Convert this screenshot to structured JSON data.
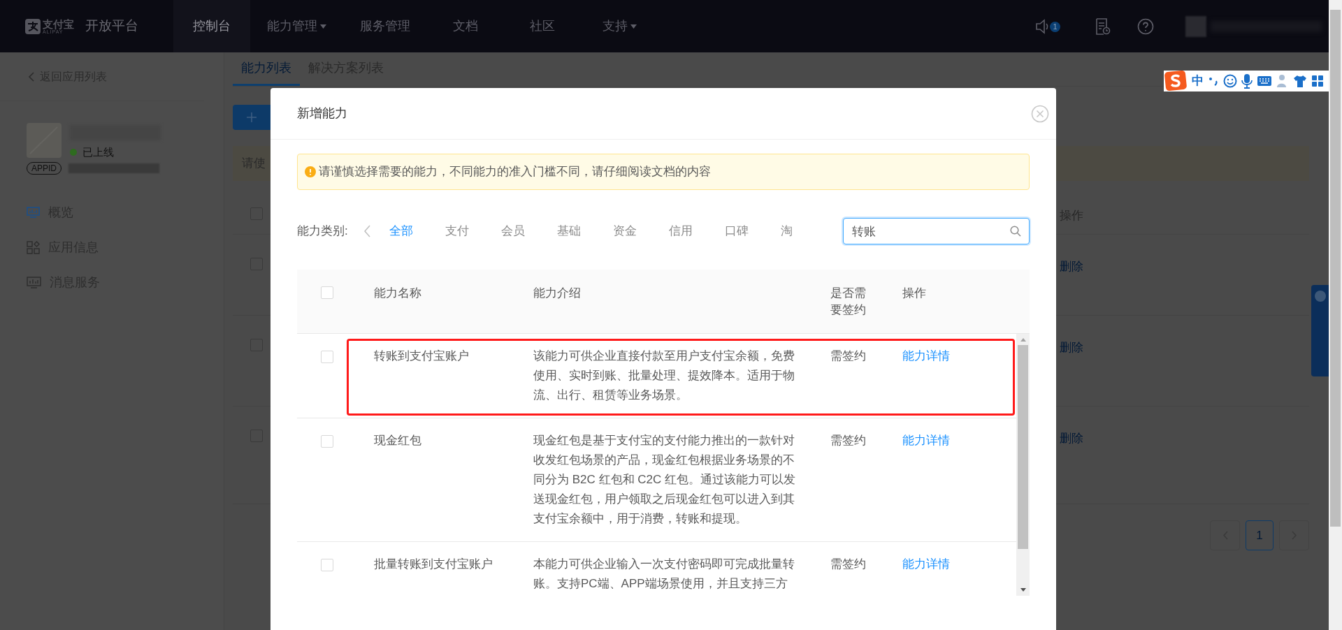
{
  "nav": {
    "logo": "支付宝",
    "logo_sub": "ALIPAY",
    "platform": "开放平台",
    "notification_count": "1",
    "items": [
      {
        "label": "控制台",
        "selected": true,
        "dropdown": false
      },
      {
        "label": "能力管理",
        "selected": false,
        "dropdown": true
      },
      {
        "label": "服务管理",
        "selected": false,
        "dropdown": false
      },
      {
        "label": "文档",
        "selected": false,
        "dropdown": false
      },
      {
        "label": "社区",
        "selected": false,
        "dropdown": false
      },
      {
        "label": "支持",
        "selected": false,
        "dropdown": true
      }
    ]
  },
  "sidebar": {
    "back": "返回应用列表",
    "status": "已上线",
    "appid_label": "APPID",
    "items": [
      {
        "label": "概览",
        "kind": "monitor",
        "selected": true
      },
      {
        "label": "应用信息",
        "kind": "grid",
        "selected": false
      },
      {
        "label": "消息服务",
        "kind": "chart",
        "selected": false
      }
    ]
  },
  "page": {
    "tabs": [
      {
        "label": "能力列表",
        "selected": true
      },
      {
        "label": "解决方案列表",
        "selected": false
      }
    ],
    "notice_fragment": "请使",
    "column_fragment": "操作",
    "rows": [
      {
        "action": "删除",
        "checked": false
      },
      {
        "action": "删除",
        "checked": false
      },
      {
        "action": "删除",
        "checked": false
      }
    ],
    "header_checked": false,
    "pages": [
      {
        "label": "1",
        "selected": true
      }
    ]
  },
  "modal": {
    "title": "新增能力",
    "alert": "请谨慎选择需要的能力，不同能力的准入门槛不同，请仔细阅读文档的内容",
    "filter": {
      "label": "能力类别:",
      "categories": [
        {
          "label": "全部",
          "selected": true
        },
        {
          "label": "支付",
          "selected": false
        },
        {
          "label": "会员",
          "selected": false
        },
        {
          "label": "基础",
          "selected": false
        },
        {
          "label": "资金",
          "selected": false
        },
        {
          "label": "信用",
          "selected": false
        },
        {
          "label": "口碑",
          "selected": false
        },
        {
          "label": "淘",
          "selected": false
        }
      ],
      "search": {
        "value": "转账"
      }
    },
    "table": {
      "header_checked": false,
      "columns": [
        "能力名称",
        "能力介绍",
        "是否需要签约",
        "操作"
      ],
      "rows": [
        {
          "checked": false,
          "highlighted": true,
          "name": "转账到支付宝账户",
          "intro": "该能力可供企业直接付款至用户支付宝余额，免费使用、实时到账、批量处理、提效降本。适用于物流、出行、租赁等业务场景。",
          "sign": "需签约",
          "action": "能力详情"
        },
        {
          "checked": false,
          "highlighted": false,
          "name": "现金红包",
          "intro": "现金红包是基于支付宝的支付能力推出的一款针对收发红包场景的产品，现金红包根据业务场景的不同分为 B2C 红包和 C2C 红包。通过该能力可以发送现金红包，用户领取之后现金红包可以进入到其支付宝余额中，用于消费，转账和提现。",
          "sign": "需签约",
          "action": "能力详情"
        },
        {
          "checked": false,
          "highlighted": false,
          "name": "批量转账到支付宝账户",
          "intro": "本能力可供企业输入一次支付密码即可完成批量转账。支持PC端、APP端场景使用，并且支持三方",
          "sign": "需签约",
          "action": "能力详情"
        }
      ]
    }
  },
  "ime": {
    "mode": "中"
  }
}
